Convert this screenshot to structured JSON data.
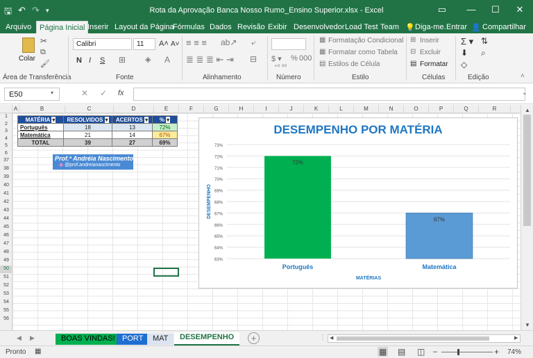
{
  "window": {
    "title": "Rota da Aprovação Banca Nosso Rumo_Ensino Superior.xlsx - Excel",
    "colors": {
      "accent": "#217346"
    }
  },
  "menu": {
    "tabs": [
      "Arquivo",
      "Página Inicial",
      "Inserir",
      "Layout da Página",
      "Fórmulas",
      "Dados",
      "Revisão",
      "Exibir",
      "Desenvolvedor",
      "Load Test",
      "Team"
    ],
    "active": "Página Inicial",
    "tell_me": "Diga-me.",
    "sign_in": "Entrar",
    "share": "Compartilhar"
  },
  "ribbon": {
    "clipboard": {
      "paste": "Colar",
      "label": "Área de Transferência"
    },
    "font": {
      "name": "Calibri",
      "size": "11",
      "bold": "N",
      "italic": "I",
      "underline": "S",
      "label": "Fonte"
    },
    "alignment": {
      "label": "Alinhamento"
    },
    "number": {
      "percent": "%",
      "thousands": "000",
      "label": "Número"
    },
    "styles": {
      "conditional": "Formatação Condicional",
      "as_table": "Formatar como Tabela",
      "cell_styles": "Estilos de Célula",
      "label": "Estilo"
    },
    "cells": {
      "insert": "Inserir",
      "delete": "Excluir",
      "format": "Formatar",
      "label": "Células"
    },
    "editing": {
      "label": "Edição"
    }
  },
  "formula_bar": {
    "name_box": "E50",
    "fx": "fx",
    "value": ""
  },
  "columns": [
    "A",
    "B",
    "C",
    "D",
    "E",
    "F",
    "G",
    "H",
    "I",
    "J",
    "K",
    "L",
    "M",
    "N",
    "O",
    "P",
    "Q",
    "R"
  ],
  "rows": [
    "1",
    "2",
    "3",
    "4",
    "5",
    "6",
    "37",
    "38",
    "39",
    "40",
    "41",
    "42",
    "43",
    "44",
    "45",
    "46",
    "47",
    "48",
    "49",
    "50",
    "51",
    "52",
    "53",
    "54",
    "55",
    "56"
  ],
  "table": {
    "headers": [
      "MATÉRIA",
      "RESOLVIDOS",
      "ACERTOS",
      "%"
    ],
    "rows": [
      {
        "materia": "Português",
        "resolvidos": "18",
        "acertos": "13",
        "pct": "72%"
      },
      {
        "materia": "Matemática",
        "resolvidos": "21",
        "acertos": "14",
        "pct": "67%"
      },
      {
        "materia": "TOTAL",
        "resolvidos": "39",
        "acertos": "27",
        "pct": "69%"
      }
    ]
  },
  "badge": {
    "name": "Prof.ª Andréia Nascimento",
    "handle": "@prof.andreianascimento"
  },
  "chart_data": {
    "type": "bar",
    "title": "DESEMPENHO POR MATÉRIA",
    "xlabel": "MATÉRIAS",
    "ylabel": "DESEMPENHO",
    "categories": [
      "Português",
      "Matemática"
    ],
    "values": [
      72,
      67
    ],
    "value_labels": [
      "72%",
      "67%"
    ],
    "bar_colors": [
      "#00b050",
      "#5b9bd5"
    ],
    "ylim": [
      63,
      73
    ],
    "yticks": [
      "63%",
      "64%",
      "65%",
      "66%",
      "67%",
      "68%",
      "69%",
      "70%",
      "71%",
      "72%",
      "73%"
    ],
    "grid": true
  },
  "sheets": {
    "tabs": [
      "BOAS VINDAS!",
      "PORT",
      "MAT",
      "DESEMPENHO"
    ],
    "active": "DESEMPENHO",
    "add": "+"
  },
  "status": {
    "mode": "Pronto",
    "zoom": "74%"
  }
}
